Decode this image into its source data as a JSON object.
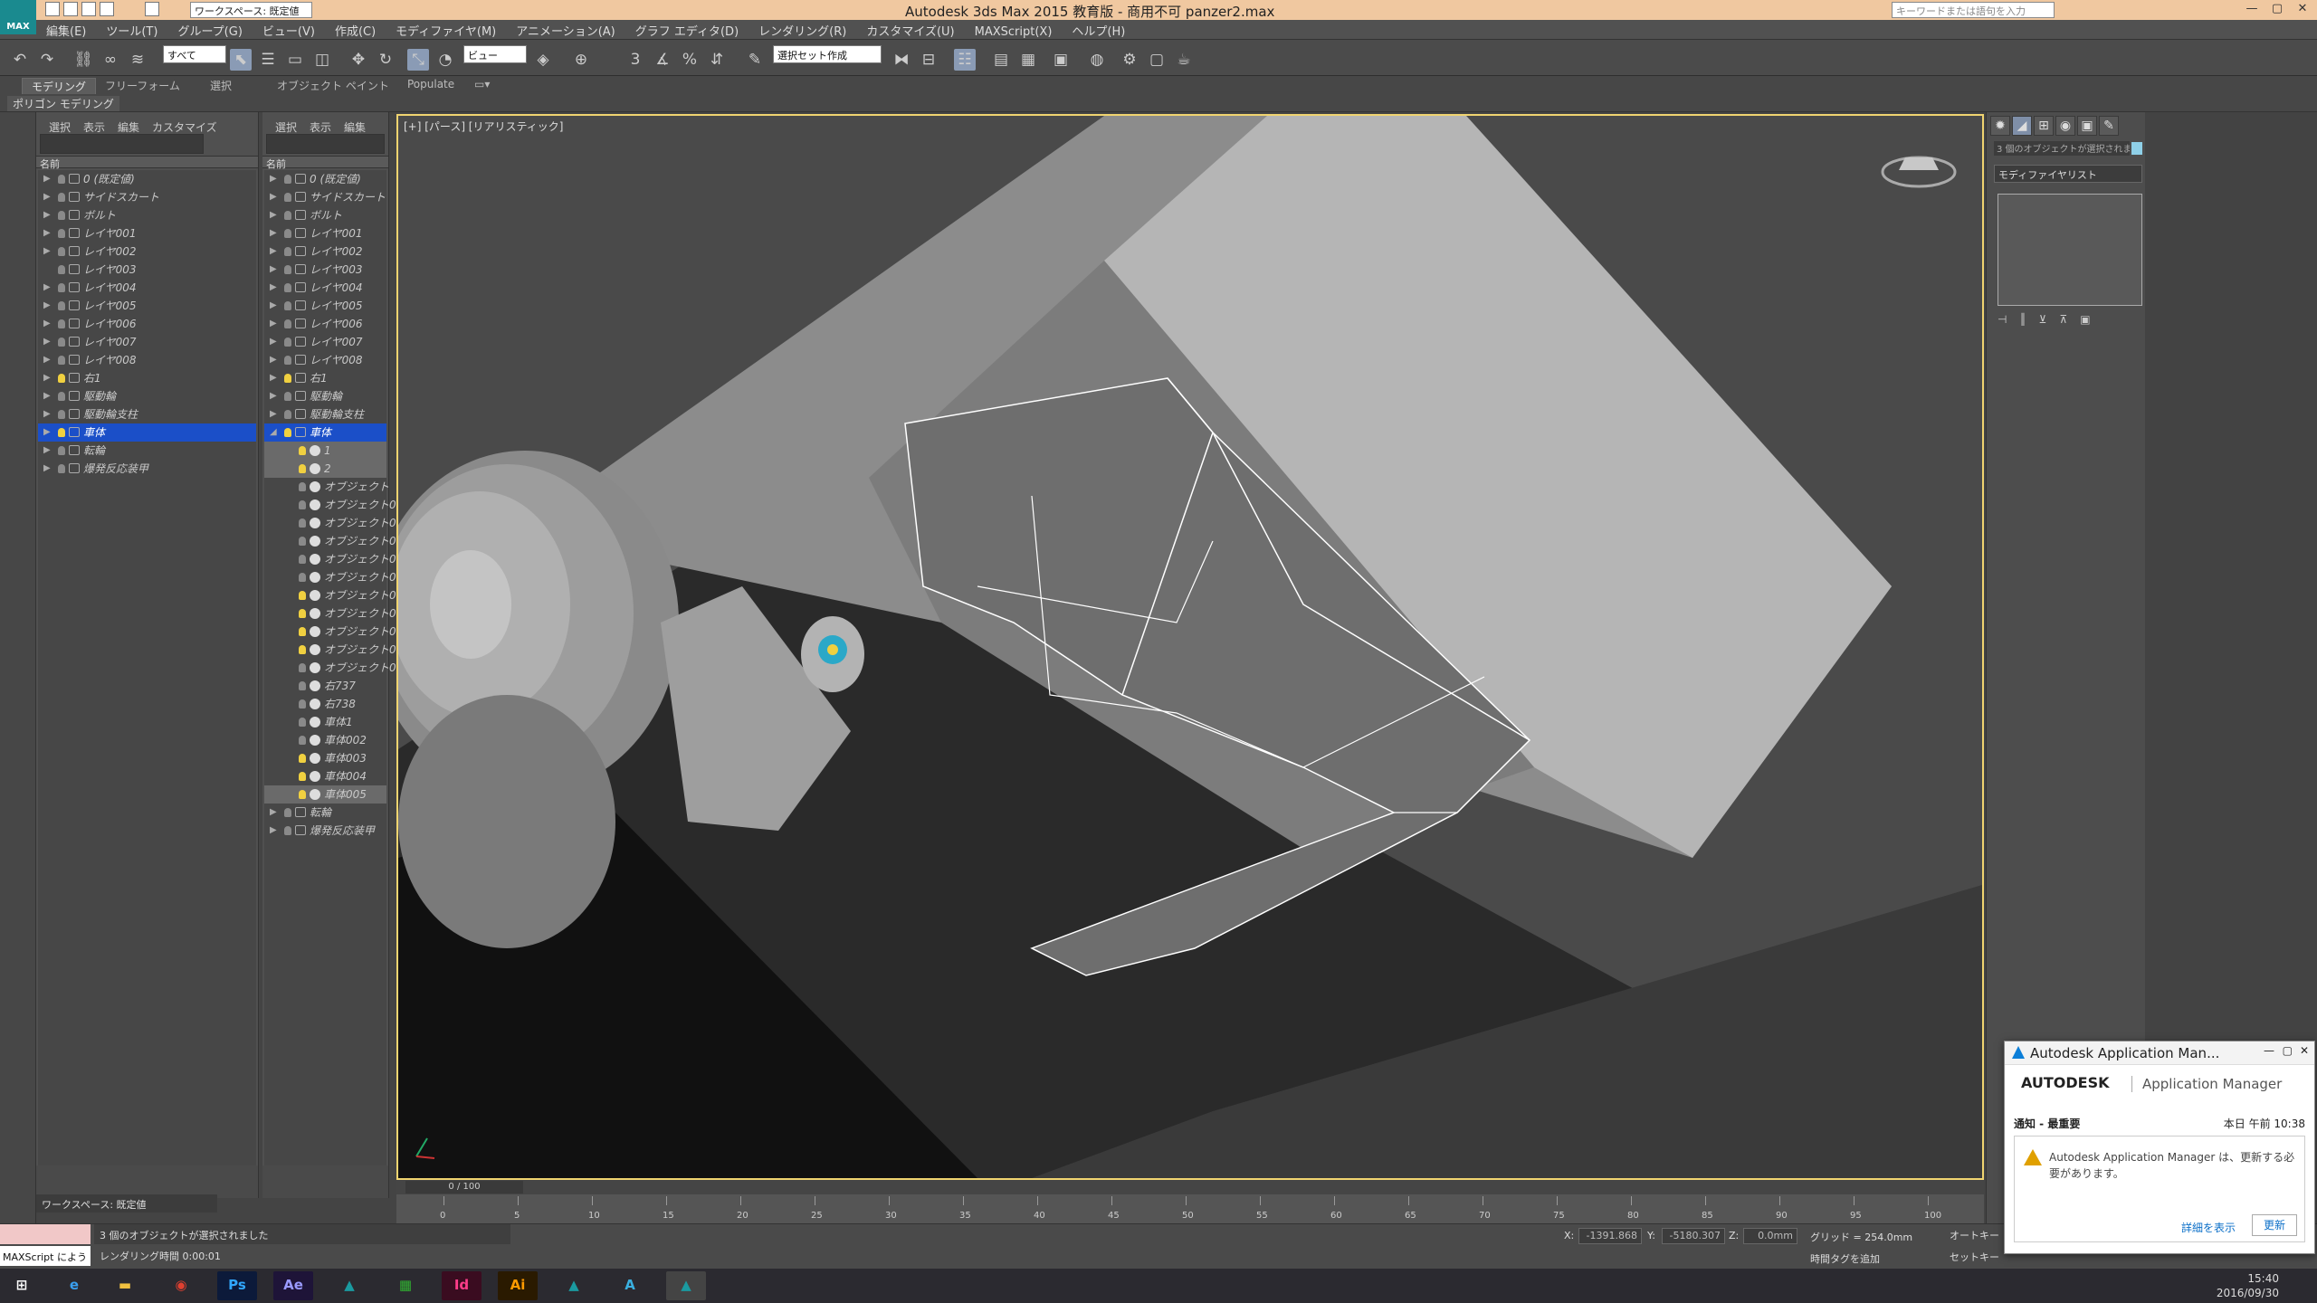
{
  "window": {
    "title": "Autodesk 3ds Max  2015  教育版 - 商用不可    panzer2.max",
    "workspace": "ワークスペース: 既定値",
    "search_placeholder": "キーワードまたは語句を入力",
    "logo": "MAX"
  },
  "menu": [
    "編集(E)",
    "ツール(T)",
    "グループ(G)",
    "ビュー(V)",
    "作成(C)",
    "モディファイヤ(M)",
    "アニメーション(A)",
    "グラフ エディタ(D)",
    "レンダリング(R)",
    "カスタマイズ(U)",
    "MAXScript(X)",
    "ヘルプ(H)"
  ],
  "toolbar": {
    "filter": "すべて",
    "refcoord": "ビュー",
    "selset": "選択セット作成"
  },
  "ribbon": {
    "tabs": [
      "モデリング",
      "フリーフォーム",
      "選択",
      "オブジェクト ペイント",
      "Populate"
    ],
    "sub": "ポリゴン モデリング"
  },
  "explorer1": {
    "menu": [
      "選択",
      "表示",
      "編集",
      "カスタマイズ"
    ],
    "column": "名前",
    "rows": [
      "0 (既定値)",
      "サイドスカート",
      "ボルト",
      "レイヤ001",
      "レイヤ002",
      "レイヤ003",
      "レイヤ004",
      "レイヤ005",
      "レイヤ006",
      "レイヤ007",
      "レイヤ008",
      "右1",
      "駆動輪",
      "駆動輪支柱",
      "車体",
      "転輪",
      "爆発反応装甲"
    ]
  },
  "explorer2": {
    "menu": [
      "選択",
      "表示",
      "編集"
    ],
    "column": "名前",
    "rows": [
      "0 (既定値)",
      "サイドスカート",
      "ボルト",
      "レイヤ001",
      "レイヤ002",
      "レイヤ003",
      "レイヤ004",
      "レイヤ005",
      "レイヤ006",
      "レイヤ007",
      "レイヤ008",
      "右1",
      "駆動輪",
      "駆動輪支柱",
      "車体"
    ],
    "children": [
      "1",
      "2",
      "オブジェクト",
      "オブジェクト0",
      "オブジェクト0",
      "オブジェクト0",
      "オブジェクト0",
      "オブジェクト0",
      "オブジェクト0",
      "オブジェクト0",
      "オブジェクト0",
      "オブジェクト0",
      "オブジェクト0",
      "右737",
      "右738",
      "車体1",
      "車体002",
      "車体003",
      "車体004",
      "車体005"
    ],
    "rows_after": [
      "転輪",
      "爆発反応装甲"
    ]
  },
  "viewport": {
    "label": "[+] [パース] [リアリスティック]"
  },
  "command_panel": {
    "selection_info": "3 個のオブジェクトが選択されま",
    "modifier_list": "モディファイヤリスト"
  },
  "timeline": {
    "frame": "0 / 100",
    "ticks": [
      "0",
      "5",
      "10",
      "15",
      "20",
      "25",
      "30",
      "35",
      "40",
      "45",
      "50",
      "55",
      "60",
      "65",
      "70",
      "75",
      "80",
      "85",
      "90",
      "95",
      "100"
    ]
  },
  "status": {
    "maxscript": "MAXScript によう",
    "message": "3 個のオブジェクトが選択されました",
    "render_time": "レンダリング時間 0:00:01",
    "x_label": "X:",
    "x": "-1391.868",
    "y_label": "Y:",
    "y": "-5180.307",
    "z_label": "Z:",
    "z": "0.0mm",
    "grid": "グリッド = 254.0mm",
    "add_tag": "時間タグを追加",
    "auto_key": "オートキー",
    "set_key": "セットキー",
    "workspace": "ワークスペース: 既定値"
  },
  "taskbar": {
    "apps": [
      "Ps",
      "Ae",
      "Id",
      "Ai"
    ],
    "time": "15:40",
    "date": "2016/09/30"
  },
  "notification": {
    "window_title": "Autodesk Application Man...",
    "brand": "AUTODESK",
    "product": "Application Manager",
    "title": "通知 - 最重要",
    "time": "本日 午前 10:38",
    "message": "Autodesk Application Manager は、更新する必要があります。",
    "details": "詳細を表示",
    "update": "更新"
  },
  "colors": {
    "title_bg": "#f0c8a0",
    "selection": "#1b4fc8",
    "viewport_border": "#f0d470",
    "accent": "#1a8a8f"
  }
}
